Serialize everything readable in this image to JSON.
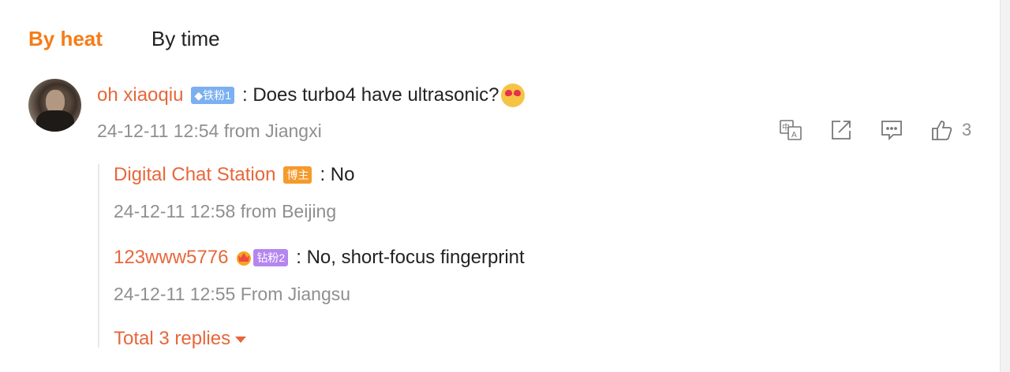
{
  "tabs": {
    "by_heat": "By heat",
    "by_time": "By time"
  },
  "comment": {
    "username": "oh xiaoqiu",
    "badge": "◆铁粉1",
    "text": ": Does turbo4 have ultrasonic?",
    "meta": "24-12-11 12:54 from Jiangxi",
    "like_count": "3"
  },
  "replies": [
    {
      "username": "Digital Chat Station",
      "badge": "博主",
      "text": ": No",
      "meta": "24-12-11 12:58 from Beijing"
    },
    {
      "username": "123www5776",
      "badge": "钻粉2",
      "text": ": No, short-focus fingerprint",
      "meta": "24-12-11 12:55 From Jiangsu"
    }
  ],
  "total_replies": "Total 3 replies",
  "colors": {
    "accent": "#f57c17",
    "username": "#e8663a",
    "meta": "#8f8f8f"
  }
}
